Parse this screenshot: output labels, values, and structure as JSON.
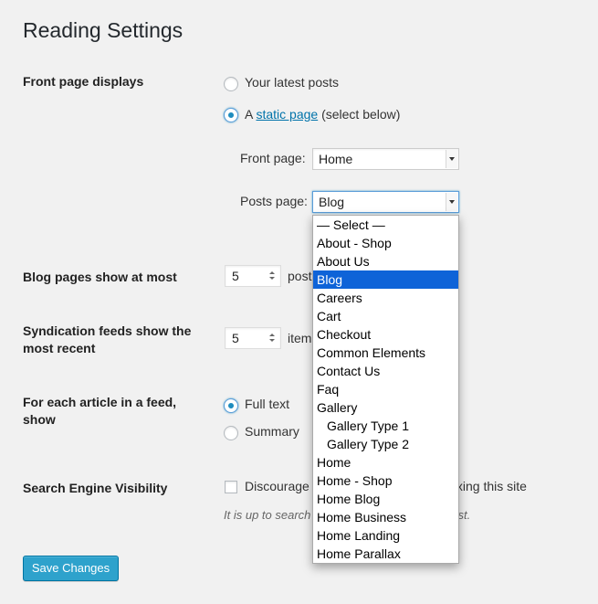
{
  "page": {
    "title": "Reading Settings"
  },
  "front_page_displays": {
    "label": "Front page displays",
    "option_latest": "Your latest posts",
    "option_static_prefix": "A",
    "option_static_link": "static page",
    "option_static_suffix": "(select below)",
    "front_page_label": "Front page:",
    "front_page_value": "Home",
    "posts_page_label": "Posts page:",
    "posts_page_value": "Blog"
  },
  "blog_pages": {
    "label": "Blog pages show at most",
    "value": "5",
    "suffix": "posts"
  },
  "syndication": {
    "label": "Syndication feeds show the most recent",
    "value": "5",
    "suffix": "items"
  },
  "feed_article": {
    "label": "For each article in a feed, show",
    "option_full": "Full text",
    "option_summary": "Summary"
  },
  "search_visibility": {
    "label": "Search Engine Visibility",
    "checkbox_label": "Discourage search engines from indexing this site",
    "description": "It is up to search engines to honor this request."
  },
  "save_button": "Save Changes",
  "posts_page_dropdown": {
    "items": [
      {
        "label": "— Select —"
      },
      {
        "label": "About - Shop"
      },
      {
        "label": "About Us"
      },
      {
        "label": "Blog"
      },
      {
        "label": "Careers"
      },
      {
        "label": "Cart"
      },
      {
        "label": "Checkout"
      },
      {
        "label": "Common Elements"
      },
      {
        "label": "Contact Us"
      },
      {
        "label": "Faq"
      },
      {
        "label": "Gallery"
      },
      {
        "label": "Gallery Type 1"
      },
      {
        "label": "Gallery Type 2"
      },
      {
        "label": "Home"
      },
      {
        "label": "Home - Shop"
      },
      {
        "label": "Home Blog"
      },
      {
        "label": "Home Business"
      },
      {
        "label": "Home Landing"
      },
      {
        "label": "Home Parallax"
      }
    ]
  }
}
